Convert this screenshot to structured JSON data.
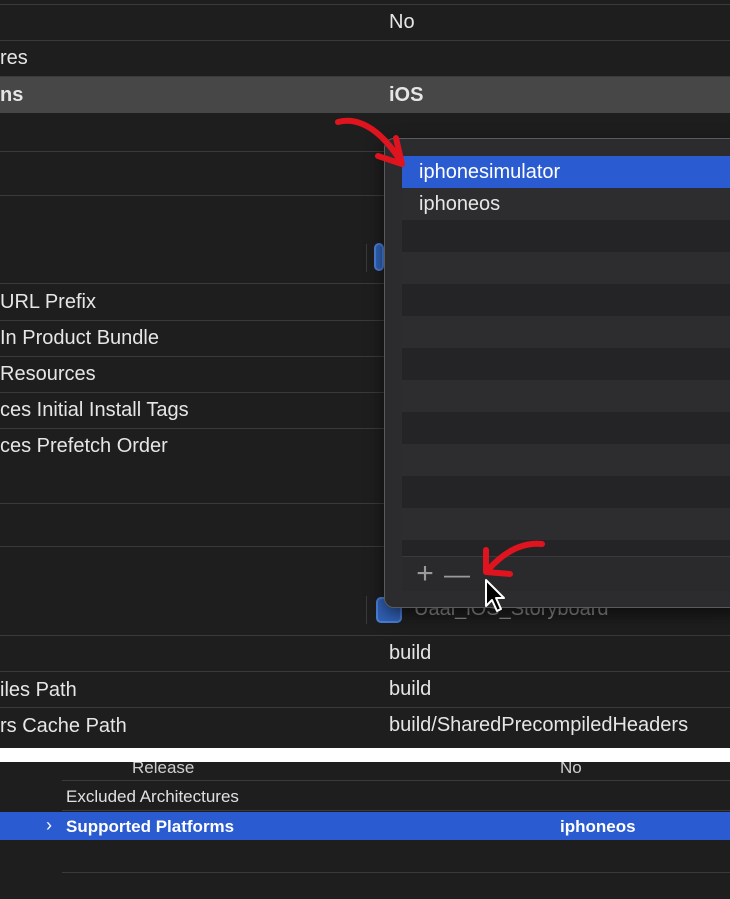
{
  "top_panel": {
    "rows": [
      {
        "left": "",
        "right": "No"
      },
      {
        "left": "res",
        "right": ""
      },
      {
        "left": "ns",
        "right": "iOS"
      },
      {
        "left": " URL Prefix",
        "right": ""
      },
      {
        "left": "In Product Bundle",
        "right": ""
      },
      {
        "left": "Resources",
        "right": ""
      },
      {
        "left": "ces Initial Install Tags",
        "right": ""
      },
      {
        "left": "ces Prefetch Order",
        "right": ""
      },
      {
        "left": "",
        "right": "build"
      },
      {
        "left": "iles Path",
        "right": "build"
      },
      {
        "left": "rs Cache Path",
        "right": "build/SharedPrecompiledHeaders"
      }
    ],
    "storyboard_label": "Uaal_iOS_Storyboard"
  },
  "popup": {
    "items": [
      "iphonesimulator",
      "iphoneos"
    ],
    "selected_index": 0,
    "add_button": "+",
    "remove_button": "—"
  },
  "bottom_panel": {
    "release_label": "Release",
    "release_value": "No",
    "excluded_label": "Excluded Architectures",
    "supported_label": "Supported Platforms",
    "supported_value": "iphoneos",
    "disclosure": "›"
  },
  "colors": {
    "background": "#1e1e1e",
    "selection": "#2a5bd0",
    "annotation_arrow": "#e0141e"
  }
}
